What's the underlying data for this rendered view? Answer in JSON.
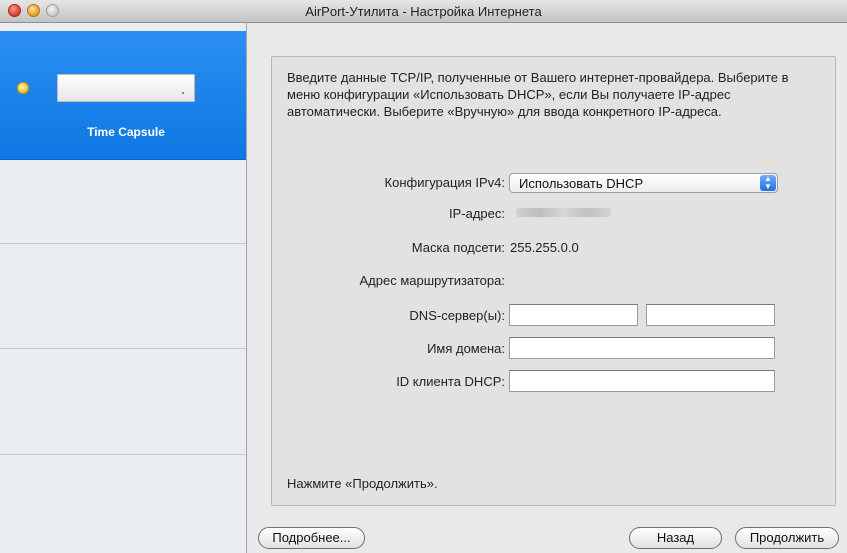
{
  "window": {
    "title": "AirPort-Утилита - Настройка Интернета"
  },
  "sidebar": {
    "device_name": "Time Capsule",
    "status_color": "#f2c21c"
  },
  "panel": {
    "intro": "Введите данные TCP/IP, полученные от Вашего интернет-провайдера. Выберите в меню конфигурации «Использовать DHCP», если Вы получаете IP-адрес автоматически. Выберите «Вручную» для ввода конкретного IP-адреса.",
    "ipv4_label": "Конфигурация IPv4:",
    "ipv4_value": "Использовать DHCP",
    "ip_label": "IP-адрес:",
    "mask_label": "Маска подсети:",
    "mask_value": "255.255.0.0",
    "router_label": "Адрес маршрутизатора:",
    "dns_label": "DNS-сервер(ы):",
    "dns1": "",
    "dns2": "",
    "domain_label": "Имя домена:",
    "domain_value": "",
    "dhcp_id_label": "ID клиента DHCP:",
    "dhcp_id_value": "",
    "footer": "Нажмите «Продолжить»."
  },
  "buttons": {
    "more": "Подробнее...",
    "back": "Назад",
    "continue": "Продолжить"
  },
  "accent_color": "#1a7fe9"
}
